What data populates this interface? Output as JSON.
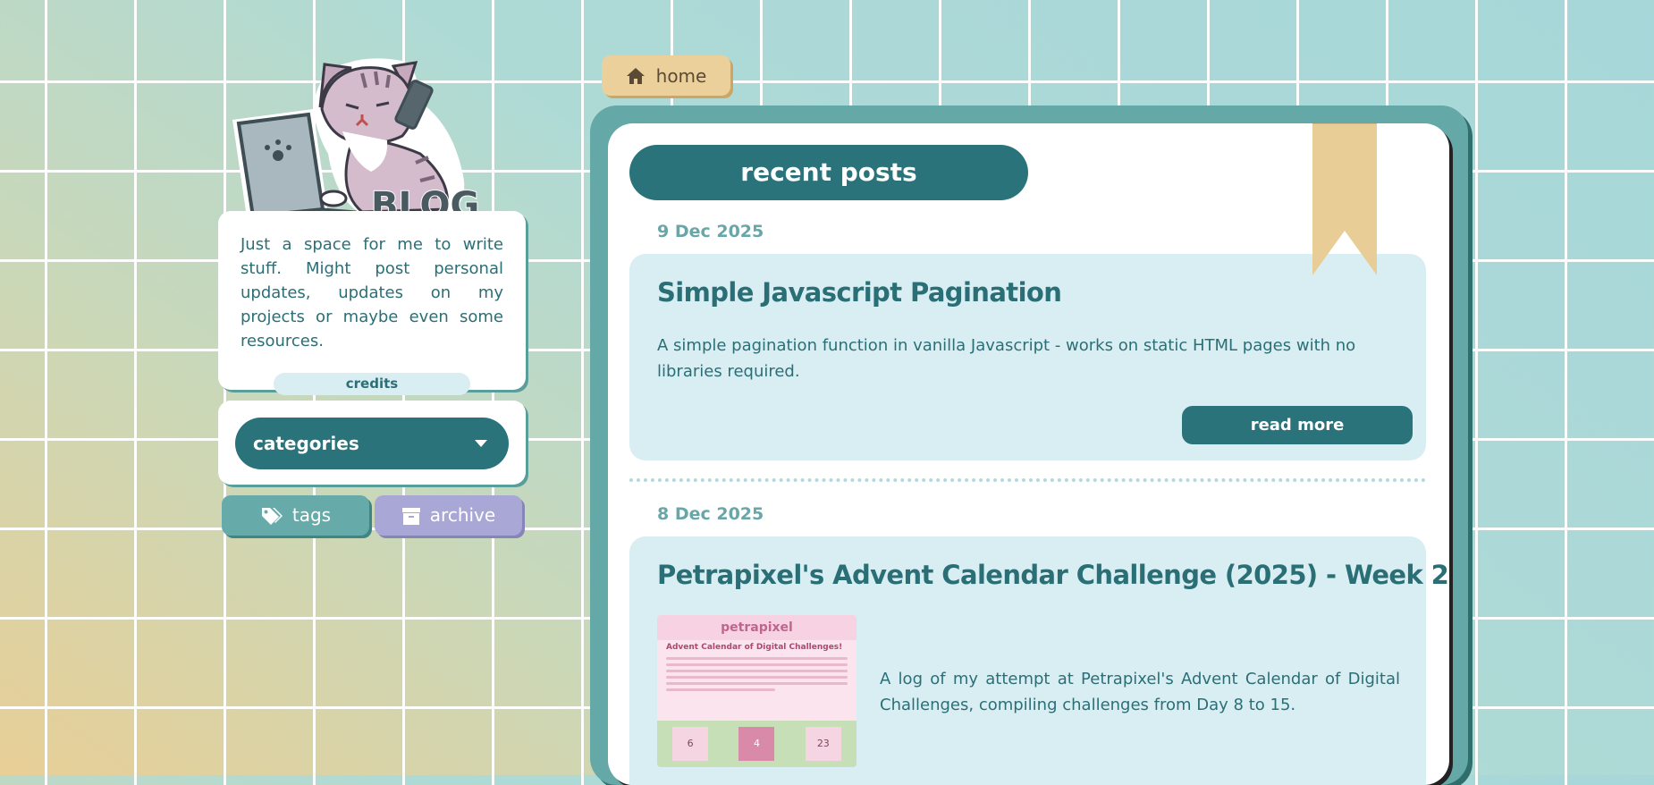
{
  "nav": {
    "home_label": "home"
  },
  "sidebar": {
    "logo_text": "BLOG",
    "about_text": "Just a space for me to write stuff. Might post personal updates, updates on my projects or maybe even some resources.",
    "credits_label": "credits",
    "categories_label": "categories",
    "tags_label": "tags",
    "archive_label": "archive"
  },
  "main": {
    "heading": "recent posts",
    "posts": [
      {
        "date": "9 Dec 2025",
        "title": "Simple Javascript Pagination",
        "excerpt": "A simple pagination function in vanilla Javascript - works on static HTML pages with no libraries required.",
        "read_more_label": "read more"
      },
      {
        "date": "8 Dec 2025",
        "title": "Petrapixel's Advent Calendar Challenge (2025) - Week 2",
        "excerpt": "A log of my attempt at Petrapixel's Advent Calendar of Digital Challenges, compiling challenges from Day 8 to 15.",
        "thumbnail": {
          "brand": "petrapixel",
          "heading": "Advent Calendar of Digital Challenges!",
          "doors": [
            "6",
            "4",
            "23"
          ]
        }
      }
    ]
  },
  "colors": {
    "teal_dark": "#2a737a",
    "teal_panel": "#64a8a7",
    "card_bg": "#d9eef3",
    "tags_btn": "#66aaa9",
    "archive_btn": "#a8a7d6",
    "home_btn": "#ecd09c",
    "ribbon": "#e8cd96"
  },
  "icons": {
    "home": "house-icon",
    "tags": "tags-icon",
    "archive": "archive-box-icon",
    "categories": "caret-down-icon"
  }
}
